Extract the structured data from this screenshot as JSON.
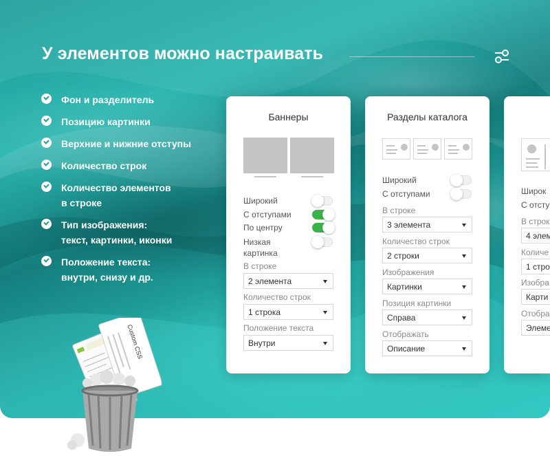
{
  "title": "У элементов можно настраивать",
  "header_icon": "settings-sliders-icon",
  "features": [
    "Фон и разделитель",
    "Позицию картинки",
    "Верхние и нижние отступы",
    "Количество строк",
    "Количество элементов\nв строке",
    "Тип изображения:\nтекст, картинки, иконки",
    "Положение текста:\nвнутри, снизу и др."
  ],
  "banners": {
    "title": "Баннеры",
    "toggles": [
      {
        "label": "Широкий",
        "on": false
      },
      {
        "label": "С отступами",
        "on": true
      },
      {
        "label": "По центру",
        "on": true
      },
      {
        "label": "Низкая картинка",
        "on": false
      }
    ],
    "fields": [
      {
        "label": "В строке",
        "value": "2 элемента"
      },
      {
        "label": "Количество строк",
        "value": "1 строка"
      },
      {
        "label": "Положение текста",
        "value": "Внутри"
      }
    ]
  },
  "catalog": {
    "title": "Разделы каталога",
    "toggles": [
      {
        "label": "Широкий",
        "on": false
      },
      {
        "label": "С отступами",
        "on": false
      }
    ],
    "fields": [
      {
        "label": "В строке",
        "value": "3 элемента"
      },
      {
        "label": "Количество строк",
        "value": "2 строки"
      },
      {
        "label": "Изображения",
        "value": "Картинки"
      },
      {
        "label": "Позиция картинки",
        "value": "Справа"
      },
      {
        "label": "Отображать",
        "value": "Описание"
      }
    ]
  },
  "third_panel": {
    "toggles": [
      "Широк",
      "С отсту"
    ],
    "fields": [
      {
        "label": "В строк",
        "value": "4 элем"
      },
      {
        "label": "Количе",
        "value": "1 строк"
      },
      {
        "label": "Изобра",
        "value": "Карти"
      },
      {
        "label": "Отобра",
        "value": "Элеме"
      }
    ]
  },
  "card_text": "Custom CSS",
  "colors": {
    "accent": "#2bb5b0",
    "toggle_on": "#3bb34a"
  }
}
